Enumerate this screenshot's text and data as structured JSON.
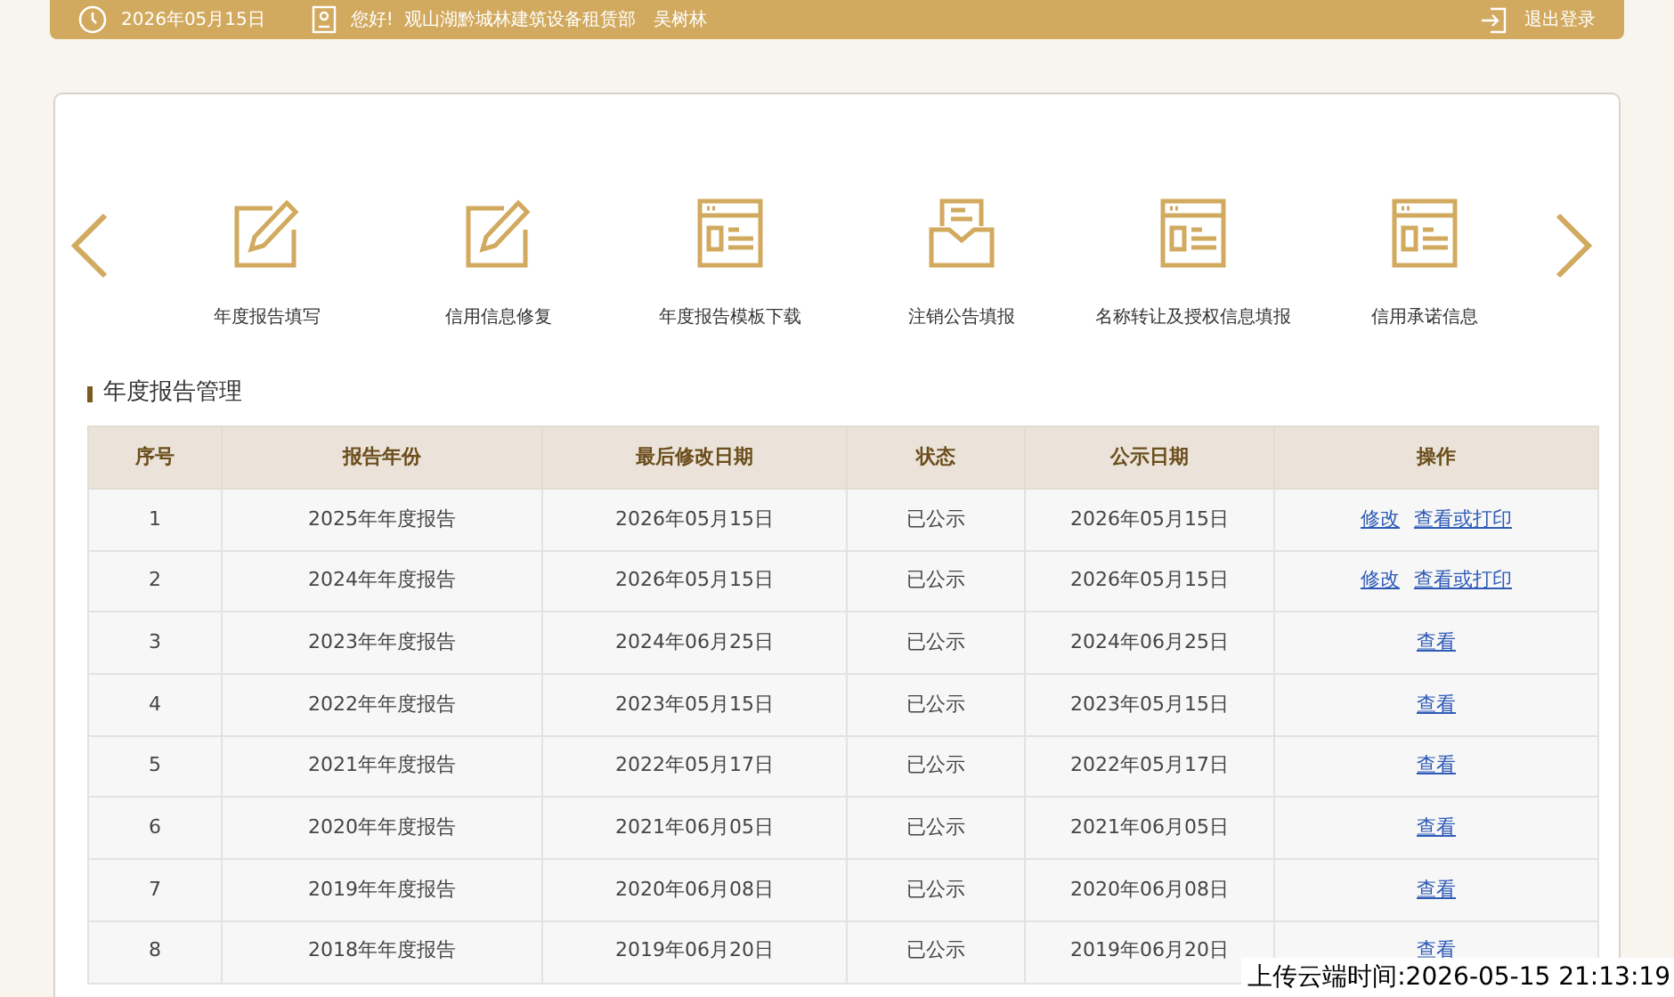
{
  "header": {
    "date": "2026年05月15日",
    "greeting": "您好!",
    "company": "观山湖黔城林建筑设备租赁部",
    "user": "吴树林",
    "logout": "退出登录"
  },
  "shortcuts": [
    {
      "label": "年度报告填写",
      "kind": "edit"
    },
    {
      "label": "信用信息修复",
      "kind": "edit"
    },
    {
      "label": "年度报告模板下载",
      "kind": "doc"
    },
    {
      "label": "注销公告填报",
      "kind": "inbox"
    },
    {
      "label": "名称转让及授权信息填报",
      "kind": "doc"
    },
    {
      "label": "信用承诺信息",
      "kind": "doc"
    }
  ],
  "section_title": "年度报告管理",
  "table": {
    "columns": [
      "序号",
      "报告年份",
      "最后修改日期",
      "状态",
      "公示日期",
      "操作"
    ],
    "rows": [
      {
        "cells": [
          "1",
          "2025年年度报告",
          "2026年05月15日",
          "已公示",
          "2026年05月15日"
        ],
        "actions": [
          "修改",
          "查看或打印"
        ]
      },
      {
        "cells": [
          "2",
          "2024年年度报告",
          "2026年05月15日",
          "已公示",
          "2026年05月15日"
        ],
        "actions": [
          "修改",
          "查看或打印"
        ]
      },
      {
        "cells": [
          "3",
          "2023年年度报告",
          "2024年06月25日",
          "已公示",
          "2024年06月25日"
        ],
        "actions": [
          "查看"
        ]
      },
      {
        "cells": [
          "4",
          "2022年年度报告",
          "2023年05月15日",
          "已公示",
          "2023年05月15日"
        ],
        "actions": [
          "查看"
        ]
      },
      {
        "cells": [
          "5",
          "2021年年度报告",
          "2022年05月17日",
          "已公示",
          "2022年05月17日"
        ],
        "actions": [
          "查看"
        ]
      },
      {
        "cells": [
          "6",
          "2020年年度报告",
          "2021年06月05日",
          "已公示",
          "2021年06月05日"
        ],
        "actions": [
          "查看"
        ]
      },
      {
        "cells": [
          "7",
          "2019年年度报告",
          "2020年06月08日",
          "已公示",
          "2020年06月08日"
        ],
        "actions": [
          "查看"
        ]
      },
      {
        "cells": [
          "8",
          "2018年年度报告",
          "2019年06月20日",
          "已公示",
          "2019年06月20日"
        ],
        "actions": [
          "查看"
        ]
      }
    ]
  },
  "upload_stamp": "上传云端时间:2026-05-15 21:13:19"
}
